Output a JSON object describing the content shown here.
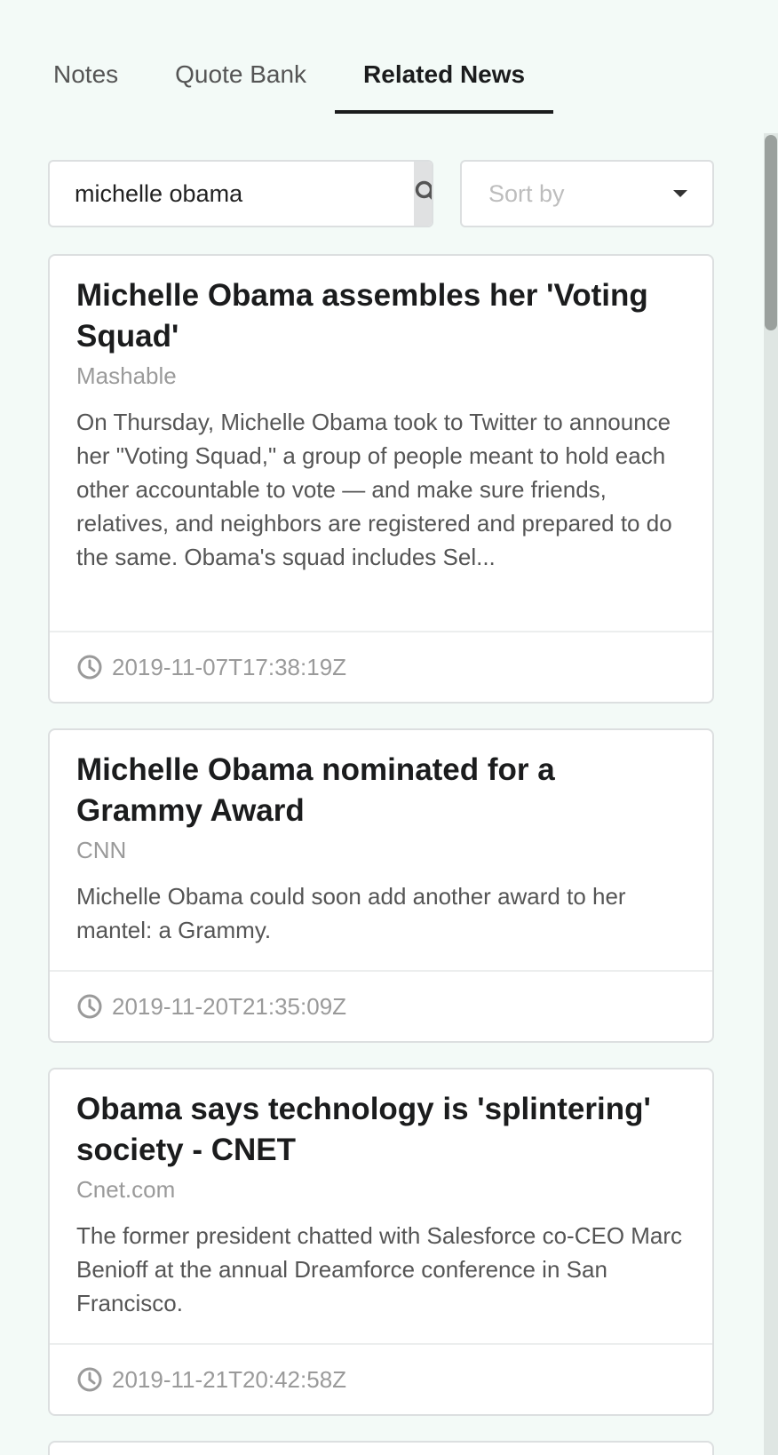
{
  "tabs": [
    {
      "label": "Notes",
      "active": false
    },
    {
      "label": "Quote Bank",
      "active": false
    },
    {
      "label": "Related News",
      "active": true
    }
  ],
  "search": {
    "value": "michelle obama",
    "button_icon": "search-icon"
  },
  "sort": {
    "placeholder": "Sort by",
    "icon": "chevron-down-icon"
  },
  "articles": [
    {
      "title": "Michelle Obama assembles her 'Voting Squad'",
      "source": "Mashable",
      "description": "On Thursday, Michelle Obama took to Twitter to announce her \"Voting Squad,\" a group of people meant to hold each other accountable to vote — and make sure friends, relatives, and neighbors are registered and prepared to do the same. Obama's squad includes Sel...",
      "timestamp": "2019-11-07T17:38:19Z"
    },
    {
      "title": "Michelle Obama nominated for a Grammy Award",
      "source": "CNN",
      "description": "Michelle Obama could soon add another award to her mantel: a Grammy.",
      "timestamp": "2019-11-20T21:35:09Z"
    },
    {
      "title": "Obama says technology is 'splintering' society - CNET",
      "source": "Cnet.com",
      "description": "The former president chatted with Salesforce co-CEO Marc Benioff at the annual Dreamforce conference in San Francisco.",
      "timestamp": "2019-11-21T20:42:58Z"
    }
  ],
  "colors": {
    "background": "#f3faf7",
    "active_tab": "#1b1c1d",
    "muted": "#9a9a9a"
  }
}
